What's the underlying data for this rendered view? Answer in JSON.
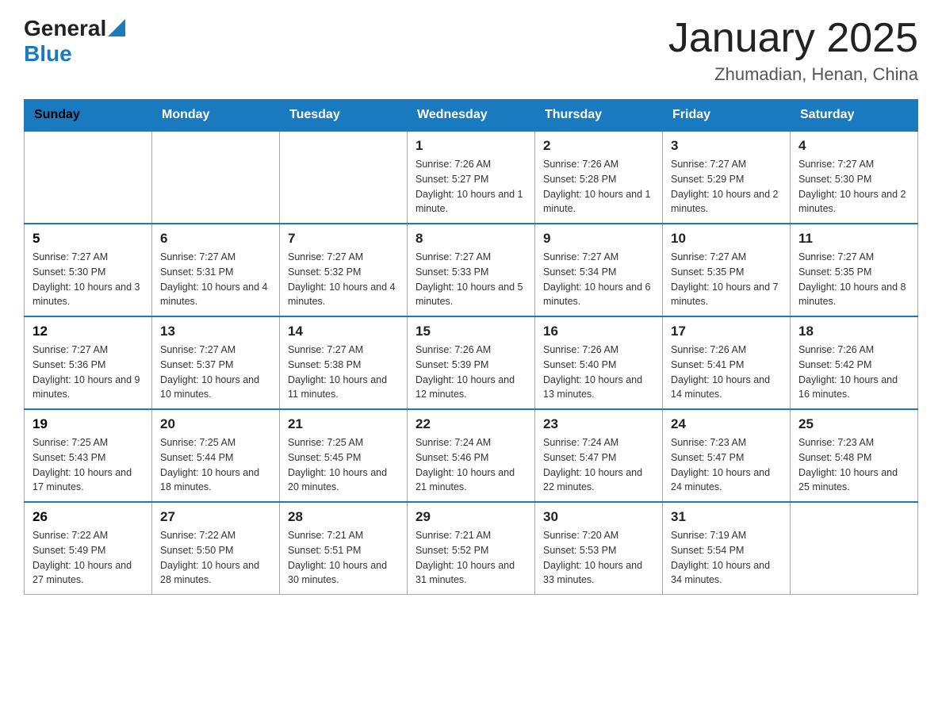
{
  "header": {
    "logo_general": "General",
    "logo_blue": "Blue",
    "title": "January 2025",
    "subtitle": "Zhumadian, Henan, China"
  },
  "calendar": {
    "days_of_week": [
      "Sunday",
      "Monday",
      "Tuesday",
      "Wednesday",
      "Thursday",
      "Friday",
      "Saturday"
    ],
    "weeks": [
      [
        {
          "day": "",
          "info": ""
        },
        {
          "day": "",
          "info": ""
        },
        {
          "day": "",
          "info": ""
        },
        {
          "day": "1",
          "info": "Sunrise: 7:26 AM\nSunset: 5:27 PM\nDaylight: 10 hours\nand 1 minute."
        },
        {
          "day": "2",
          "info": "Sunrise: 7:26 AM\nSunset: 5:28 PM\nDaylight: 10 hours\nand 1 minute."
        },
        {
          "day": "3",
          "info": "Sunrise: 7:27 AM\nSunset: 5:29 PM\nDaylight: 10 hours\nand 2 minutes."
        },
        {
          "day": "4",
          "info": "Sunrise: 7:27 AM\nSunset: 5:30 PM\nDaylight: 10 hours\nand 2 minutes."
        }
      ],
      [
        {
          "day": "5",
          "info": "Sunrise: 7:27 AM\nSunset: 5:30 PM\nDaylight: 10 hours\nand 3 minutes."
        },
        {
          "day": "6",
          "info": "Sunrise: 7:27 AM\nSunset: 5:31 PM\nDaylight: 10 hours\nand 4 minutes."
        },
        {
          "day": "7",
          "info": "Sunrise: 7:27 AM\nSunset: 5:32 PM\nDaylight: 10 hours\nand 4 minutes."
        },
        {
          "day": "8",
          "info": "Sunrise: 7:27 AM\nSunset: 5:33 PM\nDaylight: 10 hours\nand 5 minutes."
        },
        {
          "day": "9",
          "info": "Sunrise: 7:27 AM\nSunset: 5:34 PM\nDaylight: 10 hours\nand 6 minutes."
        },
        {
          "day": "10",
          "info": "Sunrise: 7:27 AM\nSunset: 5:35 PM\nDaylight: 10 hours\nand 7 minutes."
        },
        {
          "day": "11",
          "info": "Sunrise: 7:27 AM\nSunset: 5:35 PM\nDaylight: 10 hours\nand 8 minutes."
        }
      ],
      [
        {
          "day": "12",
          "info": "Sunrise: 7:27 AM\nSunset: 5:36 PM\nDaylight: 10 hours\nand 9 minutes."
        },
        {
          "day": "13",
          "info": "Sunrise: 7:27 AM\nSunset: 5:37 PM\nDaylight: 10 hours\nand 10 minutes."
        },
        {
          "day": "14",
          "info": "Sunrise: 7:27 AM\nSunset: 5:38 PM\nDaylight: 10 hours\nand 11 minutes."
        },
        {
          "day": "15",
          "info": "Sunrise: 7:26 AM\nSunset: 5:39 PM\nDaylight: 10 hours\nand 12 minutes."
        },
        {
          "day": "16",
          "info": "Sunrise: 7:26 AM\nSunset: 5:40 PM\nDaylight: 10 hours\nand 13 minutes."
        },
        {
          "day": "17",
          "info": "Sunrise: 7:26 AM\nSunset: 5:41 PM\nDaylight: 10 hours\nand 14 minutes."
        },
        {
          "day": "18",
          "info": "Sunrise: 7:26 AM\nSunset: 5:42 PM\nDaylight: 10 hours\nand 16 minutes."
        }
      ],
      [
        {
          "day": "19",
          "info": "Sunrise: 7:25 AM\nSunset: 5:43 PM\nDaylight: 10 hours\nand 17 minutes."
        },
        {
          "day": "20",
          "info": "Sunrise: 7:25 AM\nSunset: 5:44 PM\nDaylight: 10 hours\nand 18 minutes."
        },
        {
          "day": "21",
          "info": "Sunrise: 7:25 AM\nSunset: 5:45 PM\nDaylight: 10 hours\nand 20 minutes."
        },
        {
          "day": "22",
          "info": "Sunrise: 7:24 AM\nSunset: 5:46 PM\nDaylight: 10 hours\nand 21 minutes."
        },
        {
          "day": "23",
          "info": "Sunrise: 7:24 AM\nSunset: 5:47 PM\nDaylight: 10 hours\nand 22 minutes."
        },
        {
          "day": "24",
          "info": "Sunrise: 7:23 AM\nSunset: 5:47 PM\nDaylight: 10 hours\nand 24 minutes."
        },
        {
          "day": "25",
          "info": "Sunrise: 7:23 AM\nSunset: 5:48 PM\nDaylight: 10 hours\nand 25 minutes."
        }
      ],
      [
        {
          "day": "26",
          "info": "Sunrise: 7:22 AM\nSunset: 5:49 PM\nDaylight: 10 hours\nand 27 minutes."
        },
        {
          "day": "27",
          "info": "Sunrise: 7:22 AM\nSunset: 5:50 PM\nDaylight: 10 hours\nand 28 minutes."
        },
        {
          "day": "28",
          "info": "Sunrise: 7:21 AM\nSunset: 5:51 PM\nDaylight: 10 hours\nand 30 minutes."
        },
        {
          "day": "29",
          "info": "Sunrise: 7:21 AM\nSunset: 5:52 PM\nDaylight: 10 hours\nand 31 minutes."
        },
        {
          "day": "30",
          "info": "Sunrise: 7:20 AM\nSunset: 5:53 PM\nDaylight: 10 hours\nand 33 minutes."
        },
        {
          "day": "31",
          "info": "Sunrise: 7:19 AM\nSunset: 5:54 PM\nDaylight: 10 hours\nand 34 minutes."
        },
        {
          "day": "",
          "info": ""
        }
      ]
    ]
  }
}
